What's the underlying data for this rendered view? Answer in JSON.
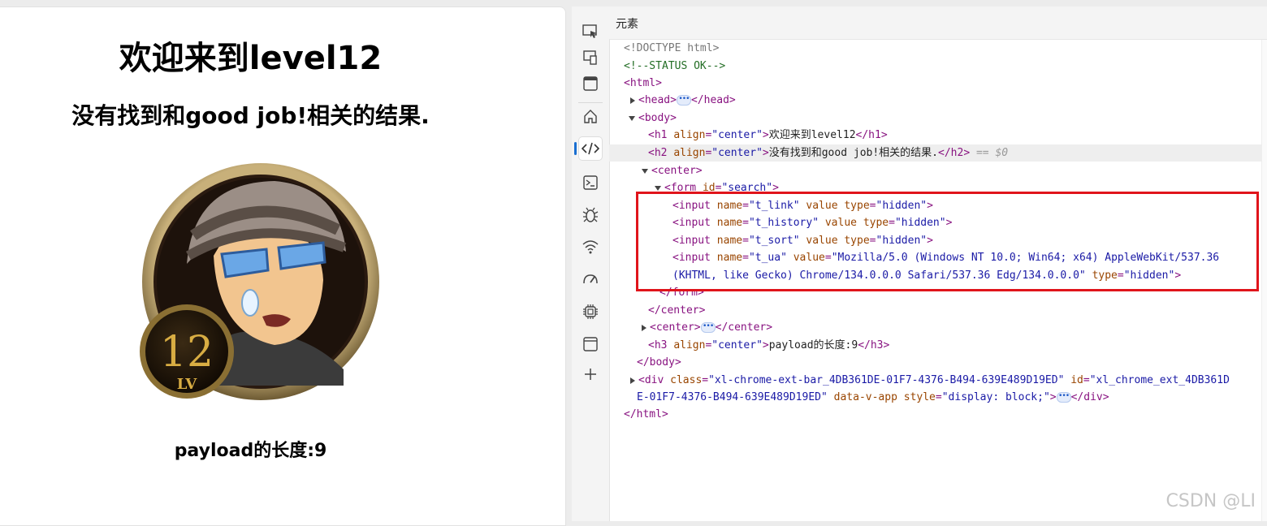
{
  "page": {
    "h1": "欢迎来到level12",
    "h2": "没有找到和good job!相关的结果.",
    "h3": "payload的长度:9",
    "badge_number": "12",
    "badge_level": "LV"
  },
  "devtools": {
    "panel_title": "元素",
    "lines": {
      "l1": "<!DOCTYPE html>",
      "l2": "<!--STATUS OK-->",
      "l3_tag": "<html>",
      "l4_open": "<head>",
      "l4_close": "</head>",
      "l5": "<body>",
      "l6_open": "<h1 ",
      "l6_attr": "align",
      "l6_val": "\"center\"",
      "l6_gt": ">",
      "l6_text": "欢迎来到level12",
      "l6_close": "</h1>",
      "l7_open": "<h2 ",
      "l7_attr": "align",
      "l7_val": "\"center\"",
      "l7_gt": ">",
      "l7_text": "没有找到和good job!相关的结果.",
      "l7_close": "</h2>",
      "l7_eq": " == $0",
      "l8": "<center>",
      "l9_open": "<form ",
      "l9_attr": "id",
      "l9_val": "\"search\"",
      "l9_gt": ">",
      "in1_name": "\"t_link\"",
      "in2_name": "\"t_history\"",
      "in3_name": "\"t_sort\"",
      "in4_name": "\"t_ua\"",
      "in4_value_a": "\"Mozilla/5.0 (Windows NT 10.0; Win64; x64) AppleWebKit/537.36",
      "in4_value_b": "(KHTML, like Gecko) Chrome/134.0.0.0 Safari/537.36 Edg/134.0.0.0\"",
      "input_tag": "<input ",
      "name_attr": "name",
      "value_attr": "value",
      "type_attr": "type",
      "hidden_val": "\"hidden\"",
      "gt": ">",
      "eq": "=",
      "form_close": "</form>",
      "center_close": "</center>",
      "center_open": "<center>",
      "h3_open": "<h3 ",
      "h3_attr": "align",
      "h3_val": "\"center\"",
      "h3_text": "payload的长度:9",
      "h3_close": "</h3>",
      "body_close": "</body>",
      "div_open": "<div ",
      "div_class_attr": "class",
      "div_class_val": "\"xl-chrome-ext-bar_4DB361DE-01F7-4376-B494-639E489D19ED\"",
      "div_id_attr": "id",
      "div_id_val_a": "\"xl_chrome_ext_4DB361D",
      "div_id_val_b": "E-01F7-4376-B494-639E489D19ED\"",
      "div_data_attr": "data-v-app",
      "div_style_attr": "style",
      "div_style_val": "\"display: block;\"",
      "div_close": "</div>",
      "html_close": "</html>"
    },
    "dots_label": "•••",
    "ellipsis": "•••"
  },
  "watermark": "CSDN @LI",
  "colors": {
    "highlight_box": "#e0141b",
    "tag": "#881280",
    "attr_name": "#994500",
    "attr_value": "#1a1aa6"
  }
}
